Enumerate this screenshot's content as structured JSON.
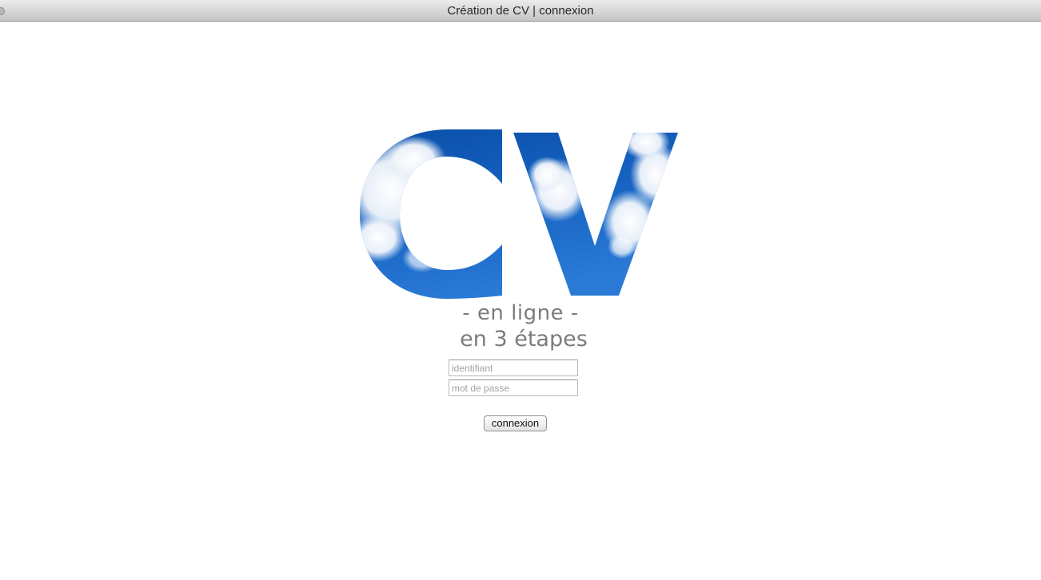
{
  "window": {
    "title": "Création de CV | connexion"
  },
  "logo": {
    "text": "CV",
    "colors": {
      "sky_dark": "#0a4fa8",
      "sky_mid": "#1e6fcf",
      "sky_light": "#5b9ae0",
      "cloud": "#ffffff"
    }
  },
  "tagline": {
    "line1": "- en ligne -",
    "line2": "en 3 étapes"
  },
  "login": {
    "username_placeholder": "identifiant",
    "password_placeholder": "mot de passe",
    "submit_label": "connexion"
  }
}
